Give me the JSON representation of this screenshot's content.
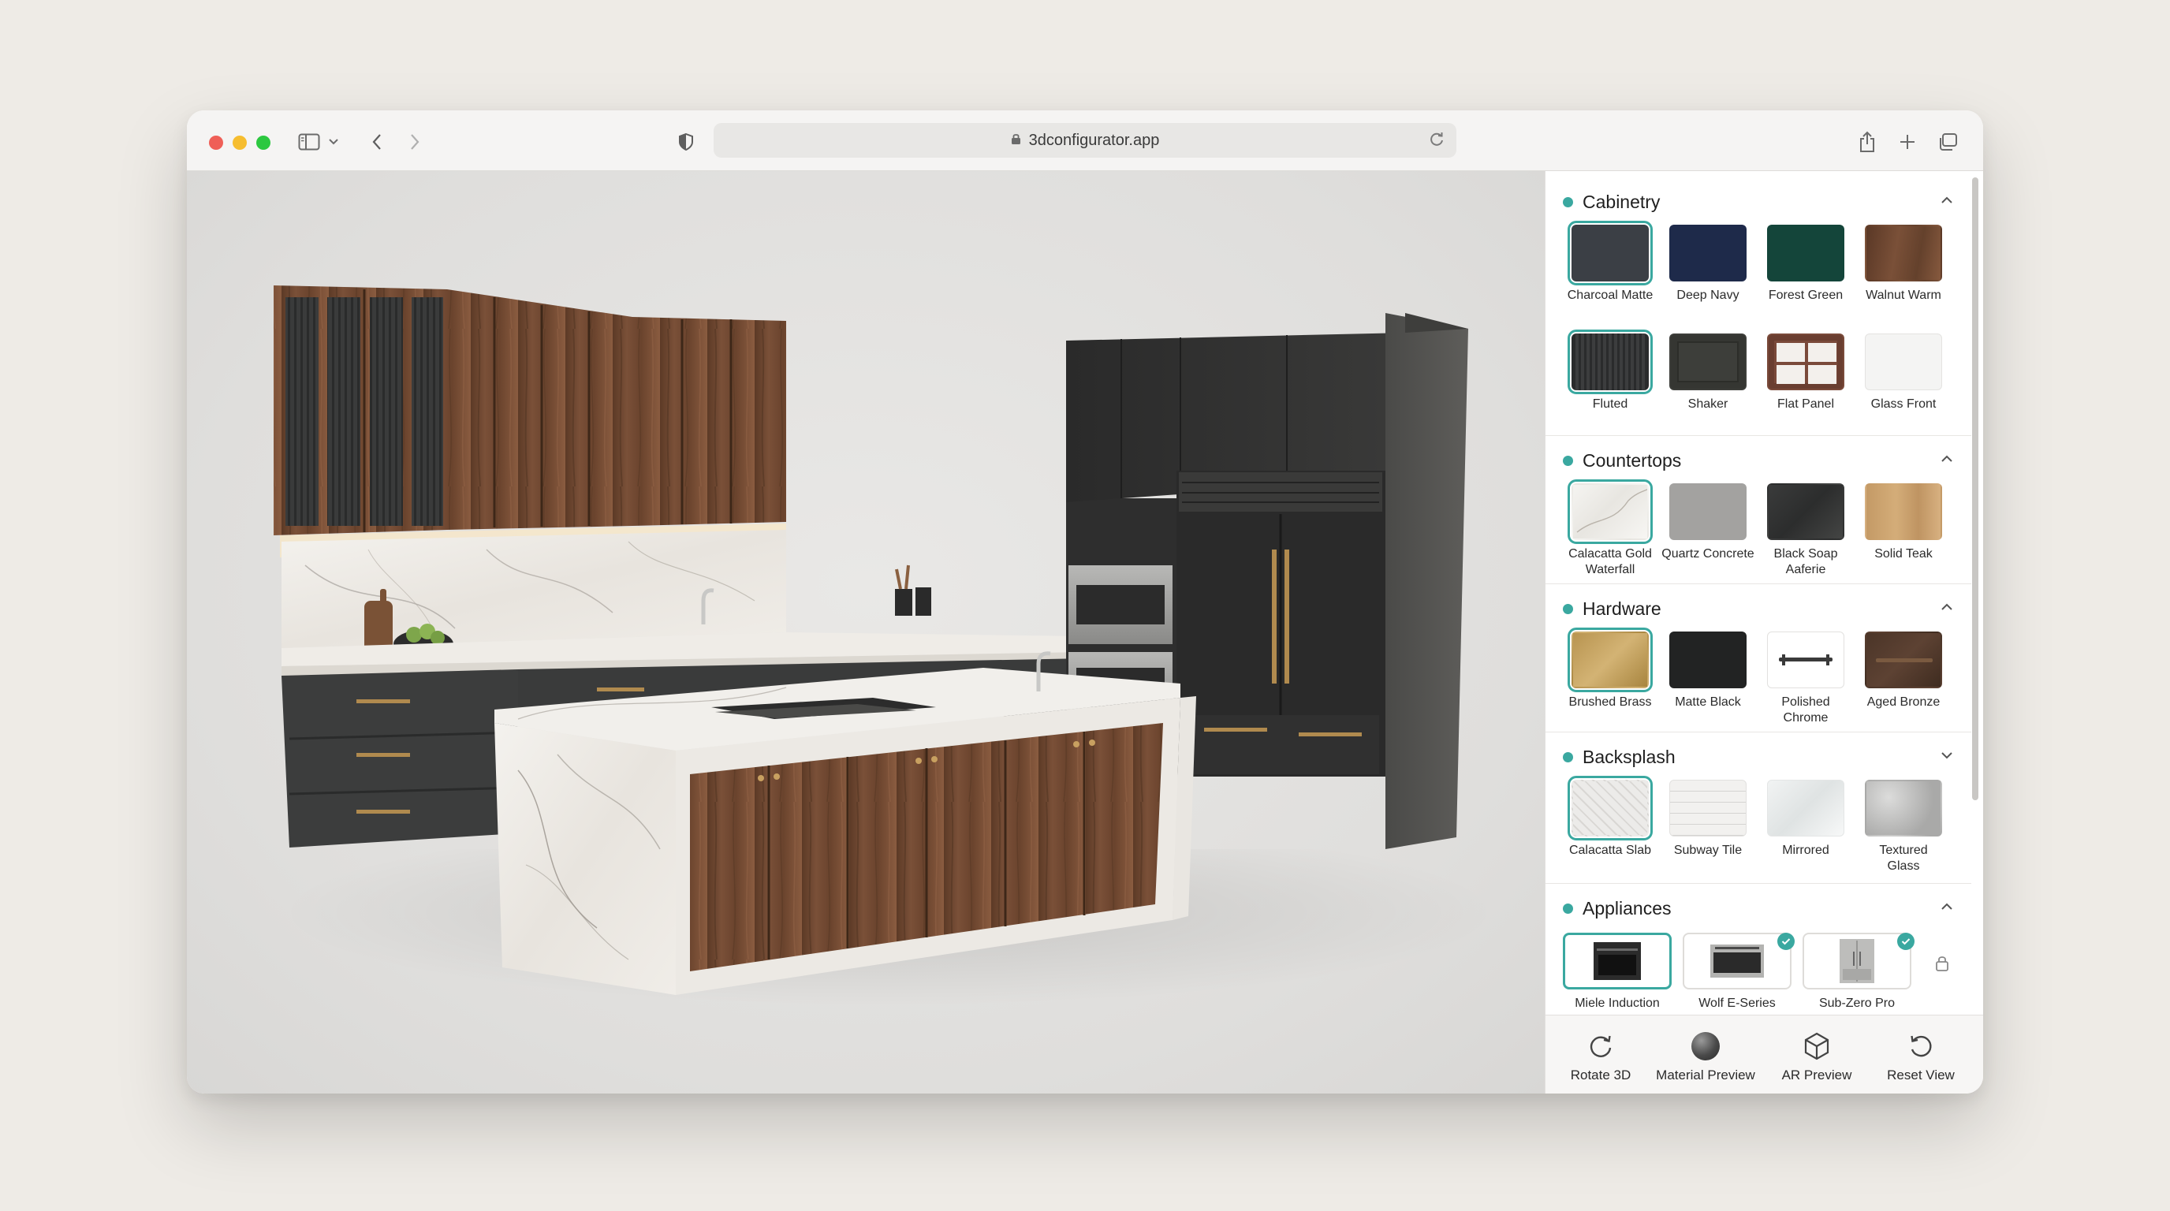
{
  "browser": {
    "url": "3dconfigurator.app"
  },
  "panel": {
    "cabinetry": {
      "title": "Cabinetry",
      "colors": [
        {
          "label": "Charcoal Matte",
          "color": "#3b3f45",
          "selected": true
        },
        {
          "label": "Deep Navy",
          "color": "#1e2a4a",
          "selected": false
        },
        {
          "label": "Forest Green",
          "color": "#14453a",
          "selected": false
        },
        {
          "label": "Walnut Warm",
          "color": "#6e4631",
          "selected": false
        }
      ],
      "styles": [
        {
          "label": "Fluted",
          "selected": true
        },
        {
          "label": "Shaker",
          "selected": false
        },
        {
          "label": "Flat Panel",
          "selected": false
        },
        {
          "label": "Glass Front",
          "selected": false
        }
      ]
    },
    "countertops": {
      "title": "Countertops",
      "items": [
        {
          "label": "Calacatta Gold Waterfall",
          "selected": true
        },
        {
          "label": "Quartz Concrete",
          "selected": false
        },
        {
          "label": "Black Soap Aaferie",
          "selected": false
        },
        {
          "label": "Solid Teak",
          "selected": false
        }
      ],
      "label_line1": "Calacatta Gold",
      "label_line2": "Waterfall",
      "label2_line1": "Quartz Concrete",
      "label3_line1": "Black Soap",
      "label3_line2": "Aaferie"
    },
    "hardware": {
      "title": "Hardware",
      "items": [
        {
          "label": "Brushed Brass",
          "selected": true
        },
        {
          "label": "Matte Black",
          "selected": false
        },
        {
          "label": "Polished Chrome",
          "selected": false
        },
        {
          "label": "Aged Bronze",
          "selected": false
        }
      ],
      "label3_line1": "Polished",
      "label3_line2": "Chrome"
    },
    "backsplash": {
      "title": "Backsplash",
      "items": [
        {
          "label": "Calacatta Slab",
          "selected": true
        },
        {
          "label": "Subway Tile",
          "selected": false
        },
        {
          "label": "Mirrored",
          "selected": false
        },
        {
          "label": "Textured Glass",
          "selected": false
        }
      ],
      "label4_line1": "Textured",
      "label4_line2": "Glass"
    },
    "appliances": {
      "title": "Appliances",
      "items": [
        {
          "label": "Miele Induction",
          "selected": true,
          "checked": false
        },
        {
          "label": "Wolf E-Series",
          "selected": false,
          "checked": true
        },
        {
          "label": "Sub-Zero Pro",
          "selected": false,
          "checked": true
        }
      ]
    },
    "actions": [
      {
        "label": "Rotate 3D",
        "icon": "rotate-icon"
      },
      {
        "label": "Material Preview",
        "icon": "sphere-icon"
      },
      {
        "label": "AR Preview",
        "icon": "cube-icon"
      },
      {
        "label": "Reset View",
        "icon": "reset-icon"
      }
    ]
  },
  "colors": {
    "accent": "#3aa8a0"
  }
}
